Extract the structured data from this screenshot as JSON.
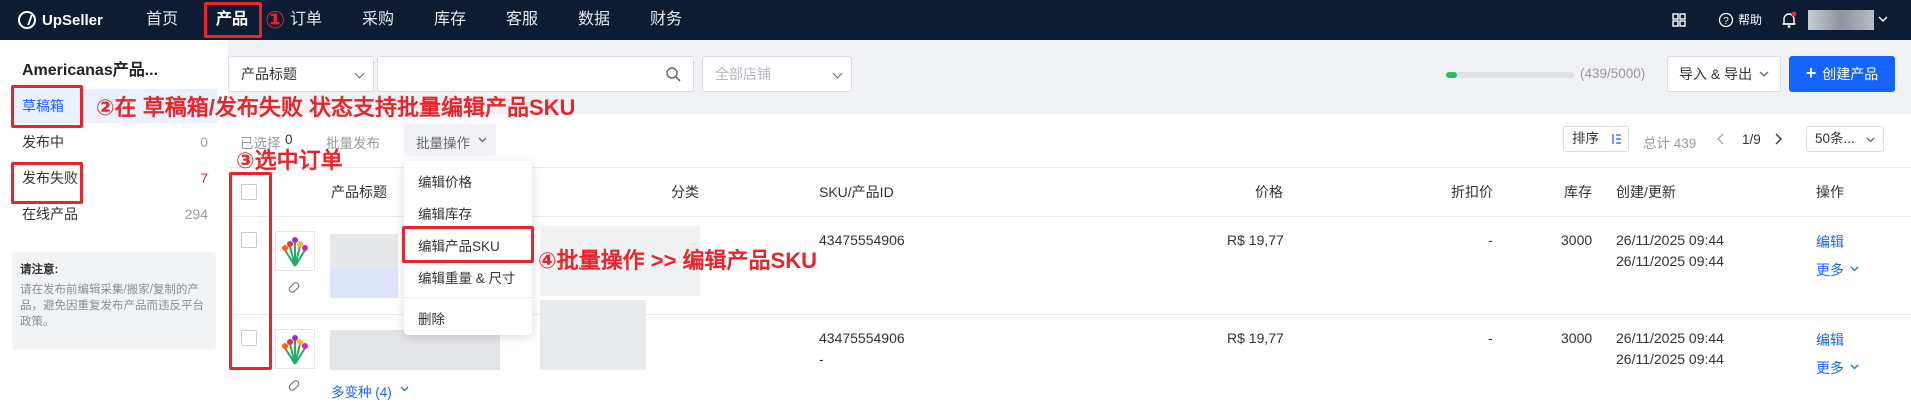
{
  "brand": {
    "name": "UpSeller"
  },
  "nav": {
    "items": [
      "首页",
      "产品",
      "订单",
      "采购",
      "库存",
      "客服",
      "数据",
      "财务"
    ],
    "active": "产品"
  },
  "top_right": {
    "help": "帮助"
  },
  "sidebar": {
    "title": "Americanas产品...",
    "items": [
      {
        "label": "草稿箱",
        "count": ""
      },
      {
        "label": "发布中",
        "count": "0"
      },
      {
        "label": "发布失败",
        "count": "7"
      },
      {
        "label": "在线产品",
        "count": "294"
      }
    ],
    "notice_title": "请注意:",
    "notice_text": "请在发布前编辑采集/搬家/复制的产品，避免因重复发布产品而违反平台政策。"
  },
  "filter": {
    "field": "产品标题",
    "search_value": "",
    "store_placeholder": "全部店铺"
  },
  "quota": {
    "text": "(439/5000)",
    "used": 439,
    "total": 5000
  },
  "actions": {
    "import_export": "导入 & 导出",
    "create": "创建产品"
  },
  "toolbar": {
    "selected_label": "已选择",
    "selected_count": "0",
    "batch_publish": "批量发布",
    "batch_ops": "批量操作",
    "sort": "排序",
    "total": "总计 439",
    "page": "1/9",
    "page_size": "50条..."
  },
  "batch_menu": [
    "编辑价格",
    "编辑库存",
    "编辑产品SKU",
    "编辑重量 & 尺寸",
    "删除"
  ],
  "table": {
    "headers": [
      "产品标题",
      "分类",
      "SKU/产品ID",
      "价格",
      "折扣价",
      "库存",
      "创建/更新",
      "操作"
    ],
    "rows": [
      {
        "sku": "43475554906",
        "sku2": "",
        "price": "R$ 19,77",
        "discount": "-",
        "stock": "3000",
        "created": "26/11/2025 09:44",
        "updated": "26/11/2025 09:44",
        "edit": "编辑",
        "more": "更多",
        "variants": ""
      },
      {
        "sku": "43475554906",
        "sku2": "-",
        "price": "R$ 19,77",
        "discount": "-",
        "stock": "3000",
        "created": "26/11/2025 09:44",
        "updated": "26/11/2025 09:44",
        "edit": "编辑",
        "more": "更多",
        "variants": "多变种 (4)"
      }
    ]
  },
  "annotations": {
    "a1": "①",
    "a2": "②在 草稿箱/发布失败 状态支持批量编辑产品SKU",
    "a3": "③选中订单",
    "a4": "④批量操作 >> 编辑产品SKU"
  },
  "colors": {
    "accent": "#1664ff",
    "annotation": "#e8252b",
    "topbar": "#0d1b33"
  }
}
